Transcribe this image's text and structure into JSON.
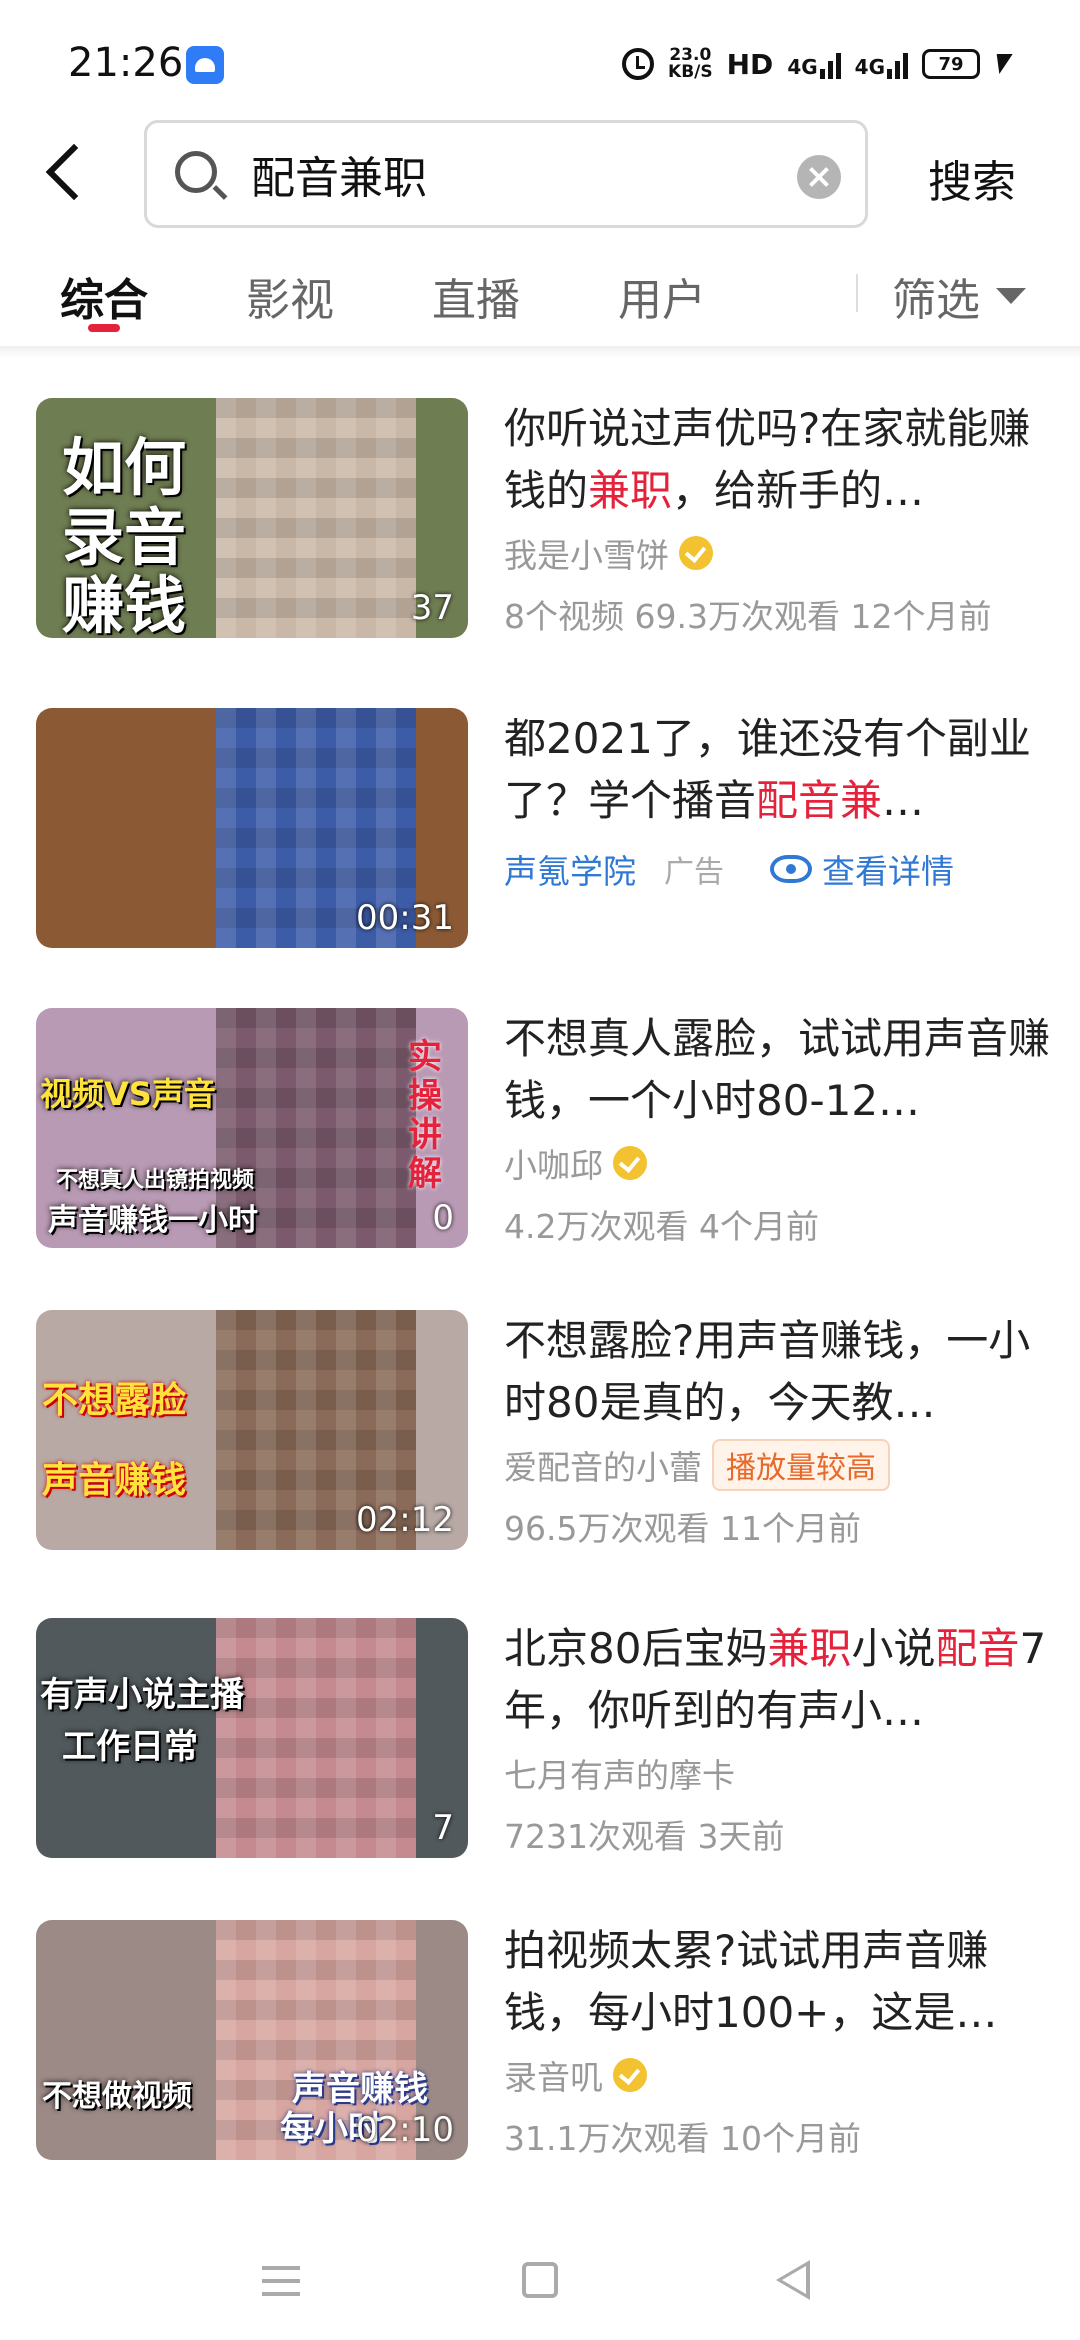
{
  "status_bar": {
    "time": "21:26",
    "net_speed_value": "23.0",
    "net_speed_unit": "KB/S",
    "hd": "HD",
    "signal1": "4G",
    "signal2": "4G",
    "battery": "79"
  },
  "search": {
    "query": "配音兼职",
    "button_label": "搜索"
  },
  "tabs": {
    "items": [
      {
        "label": "综合",
        "active": true
      },
      {
        "label": "影视",
        "active": false
      },
      {
        "label": "直播",
        "active": false
      },
      {
        "label": "用户",
        "active": false
      }
    ],
    "filter_label": "筛选"
  },
  "results": [
    {
      "title_parts": [
        "你听说过声优吗?在家就能赚钱的",
        "兼职",
        "，给新手的…"
      ],
      "author": "我是小雪饼",
      "verified": true,
      "stats": "8个视频  69.3万次观看  12个月前",
      "thumb_captions": [
        "如何",
        "录音",
        "赚钱"
      ],
      "duration": "37",
      "thumb_bg": "#6f7d52"
    },
    {
      "title_parts": [
        "都2021了，谁还没有个副业了？学个播音",
        "配音兼",
        "…"
      ],
      "author": "声氪学院",
      "ad_label": "广告",
      "ad_link": "查看详情",
      "duration": "00:31",
      "thumb_bg": "#8b5a34"
    },
    {
      "title_parts": [
        "不想真人露脸，试试用声音赚钱，一个小时80-12…"
      ],
      "author": "小咖邱",
      "verified": true,
      "stats": "4.2万次观看  4个月前",
      "thumb_captions": [
        "视频VS声音",
        "不想真人出镜拍视频",
        "声音赚钱一小时",
        "实操讲解"
      ],
      "duration": "0",
      "thumb_bg": "#b99ab4"
    },
    {
      "title_parts": [
        "不想露脸?用声音赚钱，一小时80是真的，今天教…"
      ],
      "author": "爱配音的小蕾",
      "badge": "播放量较高",
      "stats": "96.5万次观看  11个月前",
      "thumb_captions": [
        "不想露脸",
        "声音赚钱"
      ],
      "duration": "02:12",
      "thumb_bg": "#b8a9a4"
    },
    {
      "title_parts": [
        "北京80后宝妈",
        "兼职",
        "小说",
        "配音",
        "7年，你听到的有声小…"
      ],
      "author": "七月有声的摩卡",
      "stats": "7231次观看  3天前",
      "thumb_captions": [
        "有声小说主播",
        "工作日常"
      ],
      "duration": "7",
      "thumb_bg": "#51595c"
    },
    {
      "title_parts": [
        "拍视频太累?试试用声音赚钱，每小时100+，这是…"
      ],
      "author": "录音叽",
      "verified": true,
      "stats": "31.1万次观看  10个月前",
      "thumb_captions": [
        "不想做视频",
        "声音赚钱",
        "每小时"
      ],
      "duration": "02:10",
      "thumb_bg": "#9c8a86"
    }
  ]
}
